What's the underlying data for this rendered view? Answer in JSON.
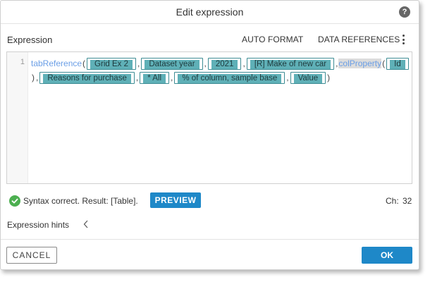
{
  "dialog": {
    "title": "Edit expression",
    "help_icon_glyph": "?"
  },
  "expression": {
    "label": "Expression",
    "auto_format_label": "AUTO FORMAT",
    "data_references_label": "DATA REFERENCES",
    "line_number": "1",
    "function_name": "tabReference",
    "nested_function_name": "colProperty",
    "open_paren": "(",
    "close_paren": ")",
    "comma": ",",
    "args": [
      "Grid Ex 2",
      "Dataset year",
      "2021",
      "[R] Make of new car"
    ],
    "nested_args": [
      "Id"
    ],
    "rest_args": [
      "Reasons for purchase",
      "* All",
      "% of column, sample base",
      "Value"
    ]
  },
  "status": {
    "icon": "check-circle-icon",
    "text": "Syntax correct. Result: [Table].",
    "preview_label": "PREVIEW",
    "ch_label": "Ch:",
    "ch_value": "32"
  },
  "hints": {
    "label": "Expression hints",
    "icon": "chevron-left-icon"
  },
  "footer": {
    "cancel_label": "CANCEL",
    "ok_label": "OK"
  },
  "colors": {
    "accent": "#1e88c8",
    "token_fill": "#5fb0b7",
    "token_border": "#3d8c94",
    "function": "#6a9ee6",
    "success": "#4caf50"
  }
}
